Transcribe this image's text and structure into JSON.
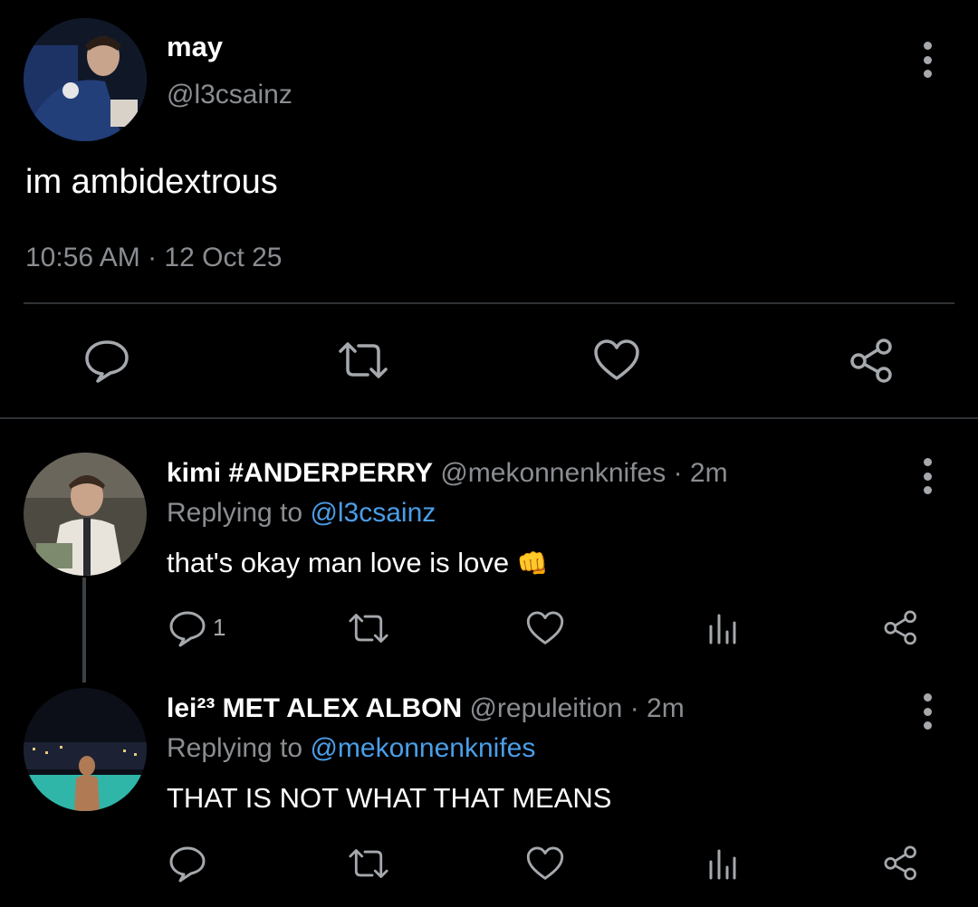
{
  "main_tweet": {
    "display_name": "may",
    "handle": "@l3csainz",
    "text": "im ambidextrous",
    "timestamp": "10:56 AM · 12 Oct 25"
  },
  "replies": [
    {
      "display_name": "kimi #ANDERPERRY",
      "handle": "@mekonnenknifes",
      "time": "· 2m",
      "replying_prefix": "Replying to",
      "replying_to": "@l3csainz",
      "text": "that's okay man love is love",
      "emoji": "👊",
      "reply_count": "1"
    },
    {
      "display_name": "lei²³ MET ALEX ALBON",
      "handle": "@repuleition",
      "time": "· 2m",
      "replying_prefix": "Replying to",
      "replying_to": "@mekonnenknifes",
      "text": "THAT IS NOT WHAT THAT MEANS"
    }
  ],
  "colors": {
    "background": "#000000",
    "text": "#e7e9ea",
    "muted": "#8a8d91",
    "link": "#4a9ee8",
    "divider": "#2f3336"
  }
}
